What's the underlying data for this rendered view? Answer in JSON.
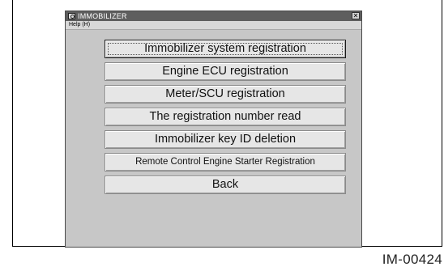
{
  "window": {
    "title": "IMMOBILIZER",
    "close_glyph": "✕",
    "icon": "app-icon"
  },
  "menubar": {
    "help_label": "Help (H)"
  },
  "buttons": [
    {
      "label": "Immobilizer system registration"
    },
    {
      "label": "Engine ECU registration"
    },
    {
      "label": "Meter/SCU registration"
    },
    {
      "label": "The registration number read"
    },
    {
      "label": "Immobilizer key ID deletion"
    },
    {
      "label": "Remote Control Engine Starter Registration"
    },
    {
      "label": "Back"
    }
  ],
  "figure_id": "IM-00424"
}
